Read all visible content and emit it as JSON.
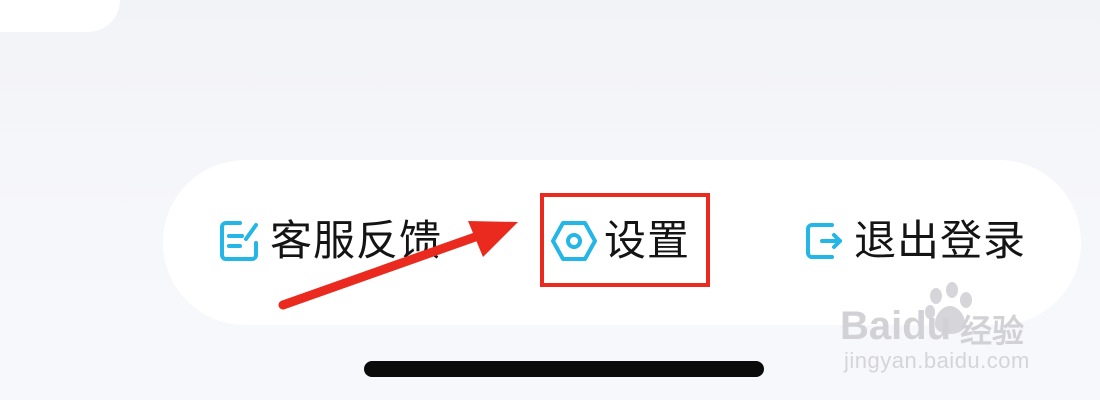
{
  "actions": [
    {
      "id": "feedback",
      "label": "客服反馈",
      "icon": "edit-note-icon"
    },
    {
      "id": "settings",
      "label": "设置",
      "icon": "settings-hexagon-icon"
    },
    {
      "id": "logout",
      "label": "退出登录",
      "icon": "logout-icon"
    }
  ],
  "colors": {
    "icon_accent": "#23b6e6",
    "highlight": "#ea2a1f",
    "label_text": "#141414",
    "bar_background": "#ffffff",
    "page_background": "#f5f6fa"
  },
  "watermark": {
    "brand": "Baidu",
    "brand_cn": "经验",
    "url": "jingyan.baidu.com"
  }
}
